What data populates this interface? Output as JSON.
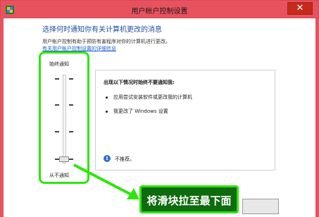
{
  "window": {
    "title": "用户帐户控制设置",
    "close_glyph": "✕"
  },
  "heading": "选择何时通知你有关计算机更改的消息",
  "description": "用户帐户控制有助于预防有害程序对你的计算机进行更改。",
  "help_link": "有关用户帐户控制设置的详细信息",
  "slider": {
    "top_label": "始终通知",
    "bottom_label": "从不通知",
    "levels": 4,
    "current_level": 1
  },
  "panel": {
    "title": "出现以下情况时始终不要通知我:",
    "bullets": [
      "应用尝试安装软件或更改我的计算机",
      "我更改了 Windows 设置"
    ],
    "info_icon": "i",
    "info_text": "不推荐。"
  },
  "annotation": {
    "text": "将滑块拉至最下面",
    "color": "#2ee60c"
  },
  "colors": {
    "titlebar": "#e8525f",
    "heading": "#1e4e9c",
    "link": "#1f5fd1",
    "close": "#c42b1c"
  }
}
